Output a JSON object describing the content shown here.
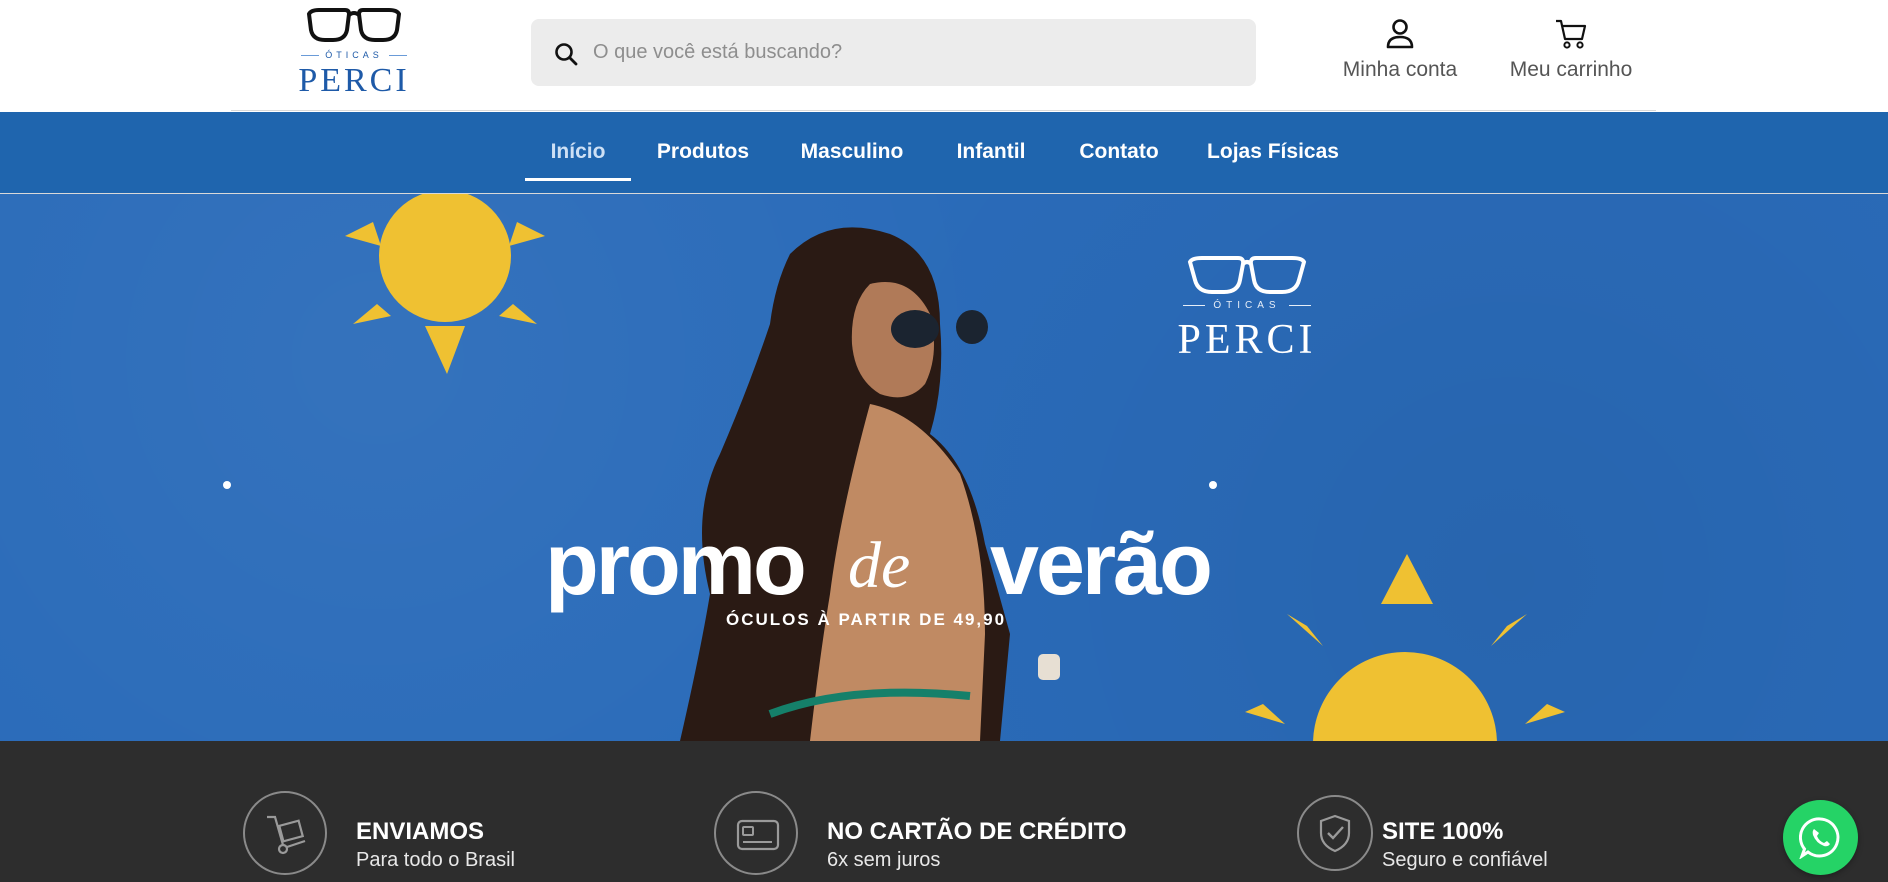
{
  "header": {
    "logo": {
      "wordmark": "PERCI",
      "subtitle": "ÓTICAS"
    },
    "search": {
      "placeholder": "O que você está buscando?",
      "value": ""
    },
    "account_label": "Minha conta",
    "cart_label": "Meu carrinho"
  },
  "nav": {
    "items": [
      {
        "label": "Início",
        "active": true
      },
      {
        "label": "Produtos",
        "active": false
      },
      {
        "label": "Masculino",
        "active": false
      },
      {
        "label": "Infantil",
        "active": false
      },
      {
        "label": "Contato",
        "active": false
      },
      {
        "label": "Lojas Físicas",
        "active": false
      }
    ]
  },
  "banner": {
    "title_part1": "promo",
    "title_part2": "de",
    "title_part3": "verão",
    "subtitle": "ÓCULOS À PARTIR DE 49,90",
    "logo": {
      "wordmark": "PERCI",
      "subtitle": "ÓTICAS"
    },
    "background_color": "#2a6bb9",
    "sun_color": "#efc132"
  },
  "features": [
    {
      "icon": "hand-truck-icon",
      "title": "ENVIAMOS",
      "text": "Para todo o Brasil"
    },
    {
      "icon": "credit-card-icon",
      "title": "NO CARTÃO DE CRÉDITO",
      "text": "6x sem juros"
    },
    {
      "icon": "shield-check-icon",
      "title": "SITE 100%",
      "text": "Seguro e confiável"
    }
  ],
  "colors": {
    "nav_blue": "#1f65ae",
    "features_bg": "#2d2d2d",
    "whatsapp_green": "#25d366"
  },
  "whatsapp": {
    "icon": "whatsapp-icon"
  }
}
